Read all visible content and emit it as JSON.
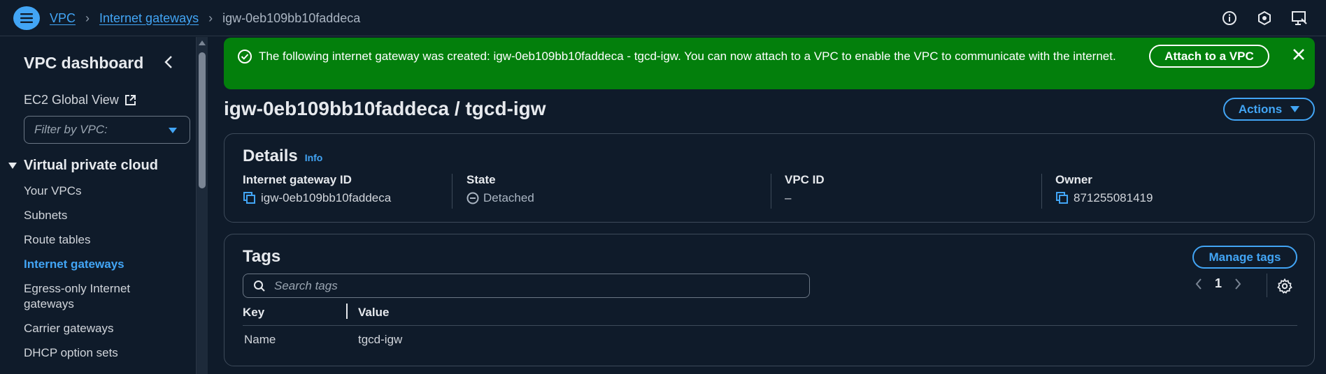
{
  "breadcrumb": {
    "vpc": "VPC",
    "internet_gateways": "Internet gateways",
    "current": "igw-0eb109bb10faddeca"
  },
  "sidebar": {
    "title": "VPC dashboard",
    "ec2_global_view": "EC2 Global View",
    "filter_placeholder": "Filter by VPC:",
    "section": "Virtual private cloud",
    "items": [
      {
        "label": "Your VPCs",
        "active": false
      },
      {
        "label": "Subnets",
        "active": false
      },
      {
        "label": "Route tables",
        "active": false
      },
      {
        "label": "Internet gateways",
        "active": true
      },
      {
        "label": "Egress-only Internet gateways",
        "active": false
      },
      {
        "label": "Carrier gateways",
        "active": false
      },
      {
        "label": "DHCP option sets",
        "active": false
      }
    ]
  },
  "flash": {
    "message": "The following internet gateway was created: igw-0eb109bb10faddeca - tgcd-igw. You can now attach to a VPC to enable the VPC to communicate with the internet.",
    "button": "Attach to a VPC",
    "color": "#037f0c"
  },
  "page": {
    "title": "igw-0eb109bb10faddeca / tgcd-igw",
    "actions": "Actions"
  },
  "details": {
    "title": "Details",
    "info": "Info",
    "fields": [
      {
        "label": "Internet gateway ID",
        "value": "igw-0eb109bb10faddeca"
      },
      {
        "label": "State",
        "value": "Detached"
      },
      {
        "label": "VPC ID",
        "value": "–"
      },
      {
        "label": "Owner",
        "value": "871255081419"
      }
    ]
  },
  "tags": {
    "title": "Tags",
    "manage": "Manage tags",
    "search_placeholder": "Search tags",
    "page": "1",
    "columns": [
      "Key",
      "Value"
    ],
    "rows": [
      {
        "key": "Name",
        "value": "tgcd-igw"
      }
    ]
  },
  "colors": {
    "accent": "#42a5f5",
    "background": "#0f1b2a",
    "success": "#037f0c"
  }
}
